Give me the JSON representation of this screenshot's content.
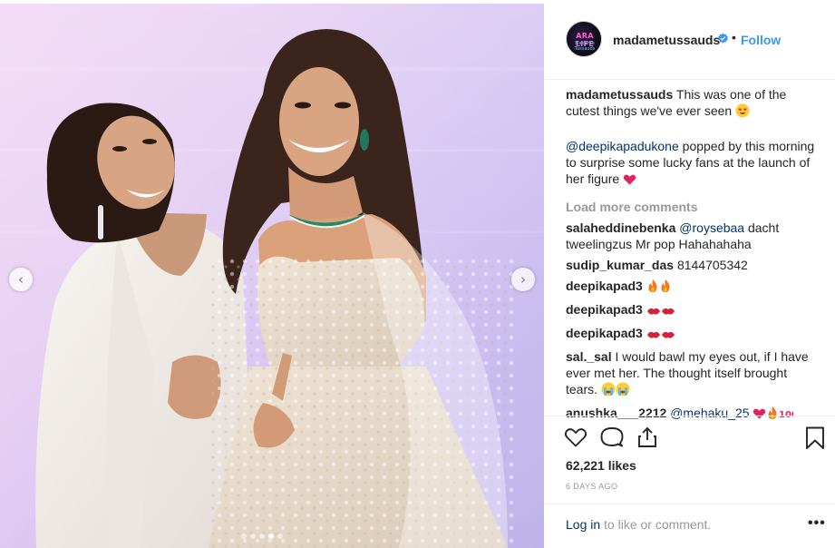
{
  "post": {
    "username": "madametussauds",
    "follow_label": "Follow",
    "separator": "•",
    "avatar_text": "ARA LIFE",
    "avatar_subtext": "Madame Tussauds"
  },
  "media": {
    "prev_label": "‹",
    "next_label": "›",
    "slide_count": 5,
    "active_slide": 4
  },
  "caption": {
    "username": "madametussauds",
    "text": " This was one of the cutest things we've ever seen ",
    "mention": "@deepikapadukone",
    "text2": " popped by this morning to surprise some lucky fans at the launch of her figure "
  },
  "load_more": "Load more comments",
  "comments": [
    {
      "user": "salaheddinebenka",
      "mention": "@roysebaa",
      "text": " dacht tweelingzus Mr pop Hahahahaha"
    },
    {
      "user": "sudip_kumar_das",
      "text": " 8144705342"
    },
    {
      "user": "deepikapad3",
      "text": " "
    },
    {
      "user": "deepikapad3",
      "text": " "
    },
    {
      "user": "deepikapad3",
      "text": " "
    },
    {
      "user": "sal._sal",
      "text": " I would bawl my eyes out, if I have ever met her. The thought itself brought tears. "
    },
    {
      "user": "anushka___2212",
      "mention": "@mehaku_25",
      "text": " "
    }
  ],
  "likes": "62,221 likes",
  "date": "6 DAYS AGO",
  "login": {
    "link": "Log in",
    "text": " to like or comment."
  },
  "more_label": "•••",
  "icons": {
    "like": "heart-outline-icon",
    "comment": "speech-bubble-icon",
    "share": "share-icon",
    "save": "bookmark-icon",
    "verified": "verified-badge-icon"
  },
  "colors": {
    "link_blue": "#3897f0",
    "mention_blue": "#003569",
    "muted": "#999999",
    "text": "#262626"
  }
}
